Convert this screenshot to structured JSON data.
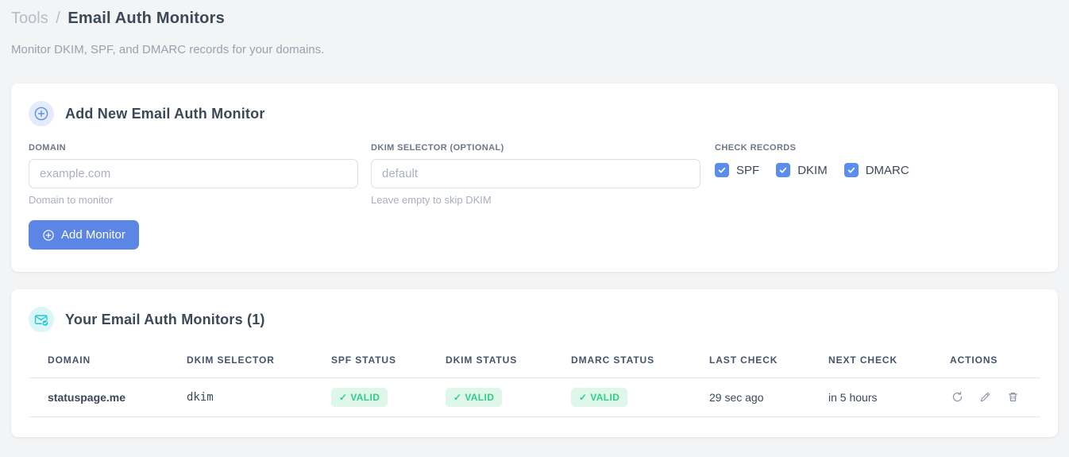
{
  "page": {
    "breadcrumb": {
      "parent": "Tools",
      "separator": "/",
      "current": "Email Auth Monitors"
    },
    "subtitle": "Monitor DKIM, SPF, and DMARC records for your domains."
  },
  "add_monitor_card": {
    "title": "Add New Email Auth Monitor",
    "header_icon": "plus-circle-icon",
    "fields": {
      "domain": {
        "label": "DOMAIN",
        "value": "",
        "placeholder": "example.com",
        "hint": "Domain to monitor"
      },
      "dkim_selector": {
        "label": "DKIM SELECTOR (OPTIONAL)",
        "value": "",
        "placeholder": "default",
        "hint": "Leave empty to skip DKIM"
      }
    },
    "check_records": {
      "label": "CHECK RECORDS",
      "options": [
        {
          "label": "SPF",
          "checked": true
        },
        {
          "label": "DKIM",
          "checked": true
        },
        {
          "label": "DMARC",
          "checked": true
        }
      ]
    },
    "submit_label": "Add Monitor"
  },
  "monitors_card": {
    "title": "Your Email Auth Monitors (1)",
    "count": 1,
    "header_icon": "email-check-icon",
    "table": {
      "columns": [
        "DOMAIN",
        "DKIM SELECTOR",
        "SPF STATUS",
        "DKIM STATUS",
        "DMARC STATUS",
        "LAST CHECK",
        "NEXT CHECK",
        "ACTIONS"
      ],
      "rows": [
        {
          "domain": "statuspage.me",
          "dkim_selector": "dkim",
          "spf_status": "✓ VALID",
          "dkim_status": "✓ VALID",
          "dmarc_status": "✓ VALID",
          "last_check": "29 sec ago",
          "next_check": "in 5 hours",
          "actions": [
            "refresh",
            "edit",
            "delete"
          ]
        }
      ]
    }
  },
  "colors": {
    "accent_blue": "#5b86e5",
    "checkbox_blue": "#5a8dee",
    "badge_green_bg": "#dff7ea",
    "badge_green_text": "#2dce89",
    "selector_pink": "#e8437e",
    "icon_teal": "#22c8d5",
    "page_background": "#f2f4f5"
  }
}
